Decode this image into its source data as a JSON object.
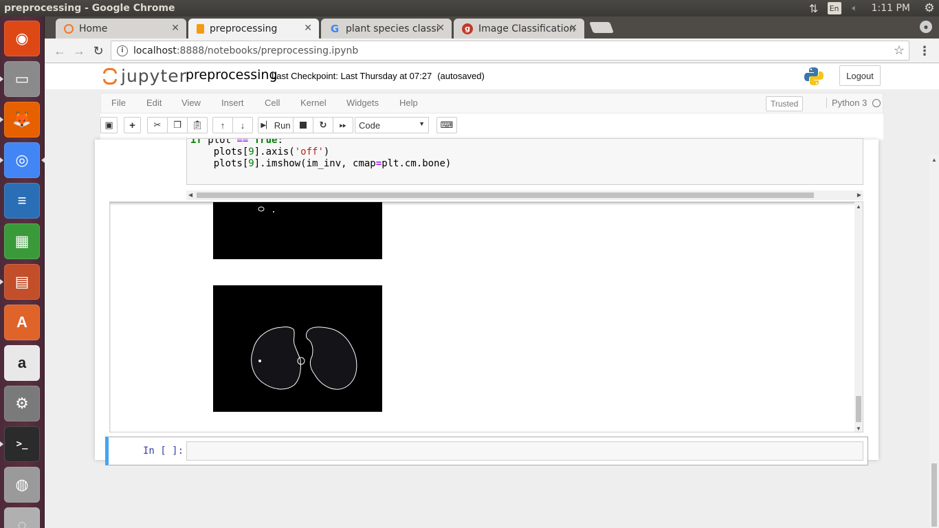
{
  "os": {
    "window_title": "preprocessing - Google Chrome",
    "keyboard_layout": "En",
    "clock": "1:11 PM",
    "launcher": [
      {
        "name": "ubuntu-dash-icon",
        "color": "#dd4814"
      },
      {
        "name": "files-icon",
        "color": "#8a8a8a"
      },
      {
        "name": "firefox-icon",
        "color": "#e66000"
      },
      {
        "name": "chrome-icon",
        "color": "#4285f4"
      },
      {
        "name": "writer-icon",
        "color": "#2a6fb5"
      },
      {
        "name": "calc-icon",
        "color": "#3a9a3a"
      },
      {
        "name": "impress-icon",
        "color": "#c24e2a"
      },
      {
        "name": "software-center-icon",
        "color": "#e0632a"
      },
      {
        "name": "amazon-icon",
        "color": "#e8e8e8"
      },
      {
        "name": "system-settings-icon",
        "color": "#7a7a7a"
      },
      {
        "name": "terminal-icon",
        "color": "#2b2b2b"
      },
      {
        "name": "disk-icon",
        "color": "#9a9a9a"
      },
      {
        "name": "drive-icon",
        "color": "#b0b0b0"
      }
    ]
  },
  "browser": {
    "tabs": [
      {
        "label": "Home",
        "icon": "jupyter-favicon"
      },
      {
        "label": "preprocessing",
        "icon": "notebook-favicon"
      },
      {
        "label": "plant species classi",
        "icon": "google-favicon"
      },
      {
        "label": "Image Classification",
        "icon": "gitbook-favicon"
      }
    ],
    "url_host": "localhost",
    "url_rest": ":8888/notebooks/preprocessing.ipynb"
  },
  "notebook": {
    "logo_text": "jupyter",
    "name": "preprocessing",
    "checkpoint": "Last Checkpoint: Last Thursday at 07:27",
    "autosave": "(autosaved)",
    "logout": "Logout",
    "menu": [
      "File",
      "Edit",
      "View",
      "Insert",
      "Cell",
      "Kernel",
      "Widgets",
      "Help"
    ],
    "trusted": "Trusted",
    "kernel": "Python 3",
    "run_label": "Run",
    "cell_type": "Code",
    "code_lines": {
      "l1_kw": "if",
      "l1_a": " plot ",
      "l1_op": "==",
      "l1_b": " ",
      "l1_true": "True",
      "l1_c": ":",
      "l2_a": "    plots[",
      "l2_num": "9",
      "l2_b": "].axis(",
      "l2_str": "'off'",
      "l2_c": ")",
      "l3_a": "    plots[",
      "l3_num": "9",
      "l3_b": "].imshow(im_inv, cmap",
      "l3_op": "=",
      "l3_c": "plt.cm.bone)"
    },
    "input_prompt": "In [ ]:"
  }
}
